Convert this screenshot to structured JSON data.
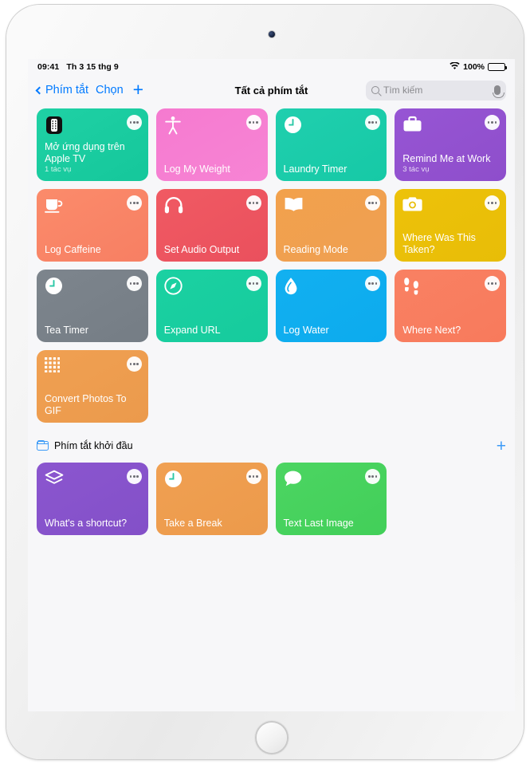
{
  "status_bar": {
    "time": "09:41",
    "date": "Th 3 15 thg 9",
    "wifi_icon": "wifi-icon",
    "battery_percent": "100%",
    "battery_icon": "battery-full-icon"
  },
  "nav": {
    "back_label": "Phím tắt",
    "back_icon": "chevron-left-icon",
    "select_label": "Chọn",
    "add_label": "+",
    "title": "Tất cả phím tắt"
  },
  "search": {
    "placeholder": "Tìm kiếm",
    "search_icon": "search-icon",
    "mic_icon": "microphone-icon"
  },
  "all_shortcuts": [
    {
      "title": "Mở ứng dụng trên Apple TV",
      "subtitle": "1 tác vụ",
      "icon": "apple-tv-remote-icon",
      "color": "#1fd1a5",
      "color2": "#15c79b"
    },
    {
      "title": "Log My Weight",
      "subtitle": "",
      "icon": "accessibility-person-icon",
      "color": "#f57ad0",
      "color2": "#f784d4"
    },
    {
      "title": "Laundry Timer",
      "subtitle": "",
      "icon": "clock-icon",
      "color": "#20cfae",
      "color2": "#16c9a6"
    },
    {
      "title": "Remind Me at Work",
      "subtitle": "3 tác vụ",
      "icon": "briefcase-icon",
      "color": "#9755d4",
      "color2": "#8e4ecb"
    },
    {
      "title": "Log Caffeine",
      "subtitle": "",
      "icon": "coffee-cup-icon",
      "color": "#fb8b6b",
      "color2": "#f77f63"
    },
    {
      "title": "Set Audio Output",
      "subtitle": "",
      "icon": "headphones-icon",
      "color": "#f05a63",
      "color2": "#ea505d"
    },
    {
      "title": "Reading Mode",
      "subtitle": "",
      "icon": "open-book-icon",
      "color": "#f2a14c",
      "color2": "#efa052"
    },
    {
      "title": "Where Was This Taken?",
      "subtitle": "",
      "icon": "camera-icon",
      "color": "#edc20a",
      "color2": "#e8bd07"
    },
    {
      "title": "Tea Timer",
      "subtitle": "",
      "icon": "clock-icon",
      "color": "#7d858d",
      "color2": "#757d85"
    },
    {
      "title": "Expand URL",
      "subtitle": "",
      "icon": "compass-icon",
      "color": "#1bd1a2",
      "color2": "#16cb9d"
    },
    {
      "title": "Log Water",
      "subtitle": "",
      "icon": "water-drop-icon",
      "color": "#12b0f0",
      "color2": "#0cabee"
    },
    {
      "title": "Where Next?",
      "subtitle": "",
      "icon": "footprints-icon",
      "color": "#f98163",
      "color2": "#f87a5c"
    },
    {
      "title": "Convert Photos To GIF",
      "subtitle": "",
      "icon": "dot-grid-icon",
      "color": "#f0a052",
      "color2": "#eb9a4c"
    }
  ],
  "folder_section": {
    "folder_icon": "folder-icon",
    "title": "Phím tắt khởi đầu",
    "add_label": "+",
    "shortcuts": [
      {
        "title": "What's a shortcut?",
        "subtitle": "",
        "icon": "layers-icon",
        "color": "#8b56cf",
        "color2": "#8350c8"
      },
      {
        "title": "Take a Break",
        "subtitle": "",
        "icon": "clock-icon",
        "color": "#f0a052",
        "color2": "#ec9a4b"
      },
      {
        "title": "Text Last Image",
        "subtitle": "",
        "icon": "speech-bubble-icon",
        "color": "#4cd562",
        "color2": "#42cf59"
      }
    ]
  },
  "colors": {
    "accent": "#007aff",
    "screen_bg": "#f7f7f9",
    "search_bg": "#e6e6eb"
  }
}
